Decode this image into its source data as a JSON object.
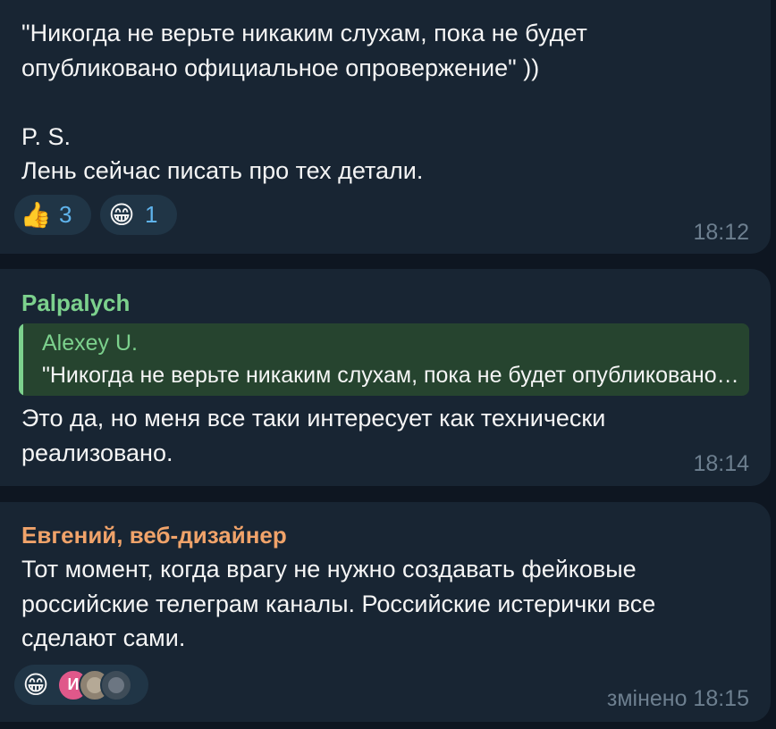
{
  "messages": [
    {
      "text": "\"Никогда не верьте никаким слухам, пока не будет\nопубликовано официальное опровержение\" ))\n\nP. S.\nЛень сейчас писать про тех детали.",
      "reactions": [
        {
          "emoji": "👍",
          "count": "3"
        },
        {
          "emoji": "😁",
          "count": "1"
        }
      ],
      "time": "18:12"
    },
    {
      "author": "Palpalych",
      "reply": {
        "author": "Alexey U.",
        "text": "\"Никогда не верьте никаким слухам, пока не будет опубликовано официальное опровержение\" ))"
      },
      "text": "Это да, но меня все таки интересует как технически\nреализовано.",
      "time": "18:14"
    },
    {
      "author": "Евгений, веб-дизайнер",
      "text": "Тот момент, когда врагу не нужно создавать фейковые\nроссийские телеграм каналы. Российские истерички все\nсделают сами.",
      "reaction": {
        "emoji": "😁",
        "avatar_initial": "И"
      },
      "time": "змінено 18:15"
    }
  ],
  "colors": {
    "background": "#0e1621",
    "bubble": "#182533",
    "author_green": "#7cd18d",
    "author_orange": "#f0a36a",
    "reaction_count": "#5fb3ec",
    "timestamp": "#6d7f8f"
  }
}
